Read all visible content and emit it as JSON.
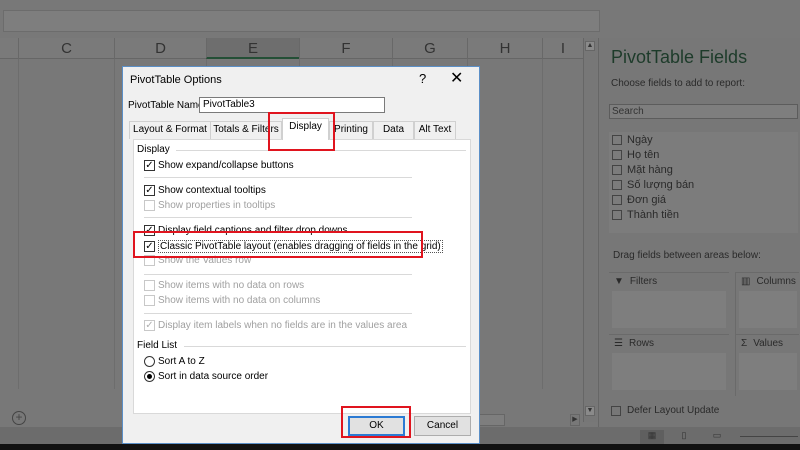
{
  "sheet": {
    "columns": [
      "C",
      "D",
      "E",
      "F",
      "G",
      "H",
      "I"
    ],
    "selected_column": "E"
  },
  "panel": {
    "title": "PivotTable Fields",
    "choose_label": "Choose fields to add to report:",
    "search_placeholder": "Search",
    "fields": [
      "Ngày",
      "Họ tên",
      "Mặt hàng",
      "Số lượng bán",
      "Đơn giá",
      "Thành tiền"
    ],
    "drag_label": "Drag fields between areas below:",
    "areas": {
      "filters": "Filters",
      "columns": "Columns",
      "rows": "Rows",
      "values": "Values"
    },
    "defer_label": "Defer Layout Update"
  },
  "dialog": {
    "title": "PivotTable Options",
    "help": "?",
    "close": "✕",
    "name_label": "PivotTable Name:",
    "name_value": "PivotTable3",
    "tabs": [
      "Layout & Format",
      "Totals & Filters",
      "Display",
      "Printing",
      "Data",
      "Alt Text"
    ],
    "active_tab": "Display",
    "display_group": "Display",
    "options": [
      {
        "label": "Show expand/collapse buttons",
        "checked": true,
        "enabled": true
      },
      {
        "label": "Show contextual tooltips",
        "checked": true,
        "enabled": true
      },
      {
        "label": "Show properties in tooltips",
        "checked": false,
        "enabled": false
      },
      {
        "label": "Display field captions and filter drop downs",
        "checked": true,
        "enabled": true
      },
      {
        "label": "Classic PivotTable layout (enables dragging of fields in the grid)",
        "checked": true,
        "enabled": true
      },
      {
        "label": "Show the Values row",
        "checked": false,
        "enabled": false
      },
      {
        "label": "Show items with no data on rows",
        "checked": false,
        "enabled": false
      },
      {
        "label": "Show items with no data on columns",
        "checked": false,
        "enabled": false
      },
      {
        "label": "Display item labels when no fields are in the values area",
        "checked": true,
        "enabled": false
      }
    ],
    "field_list_group": "Field List",
    "sort_options": [
      {
        "label": "Sort A to Z",
        "selected": false
      },
      {
        "label": "Sort in data source order",
        "selected": true
      }
    ],
    "ok": "OK",
    "cancel": "Cancel"
  },
  "colors": {
    "highlight": "#e0141e",
    "accent": "#2b7ad3"
  }
}
